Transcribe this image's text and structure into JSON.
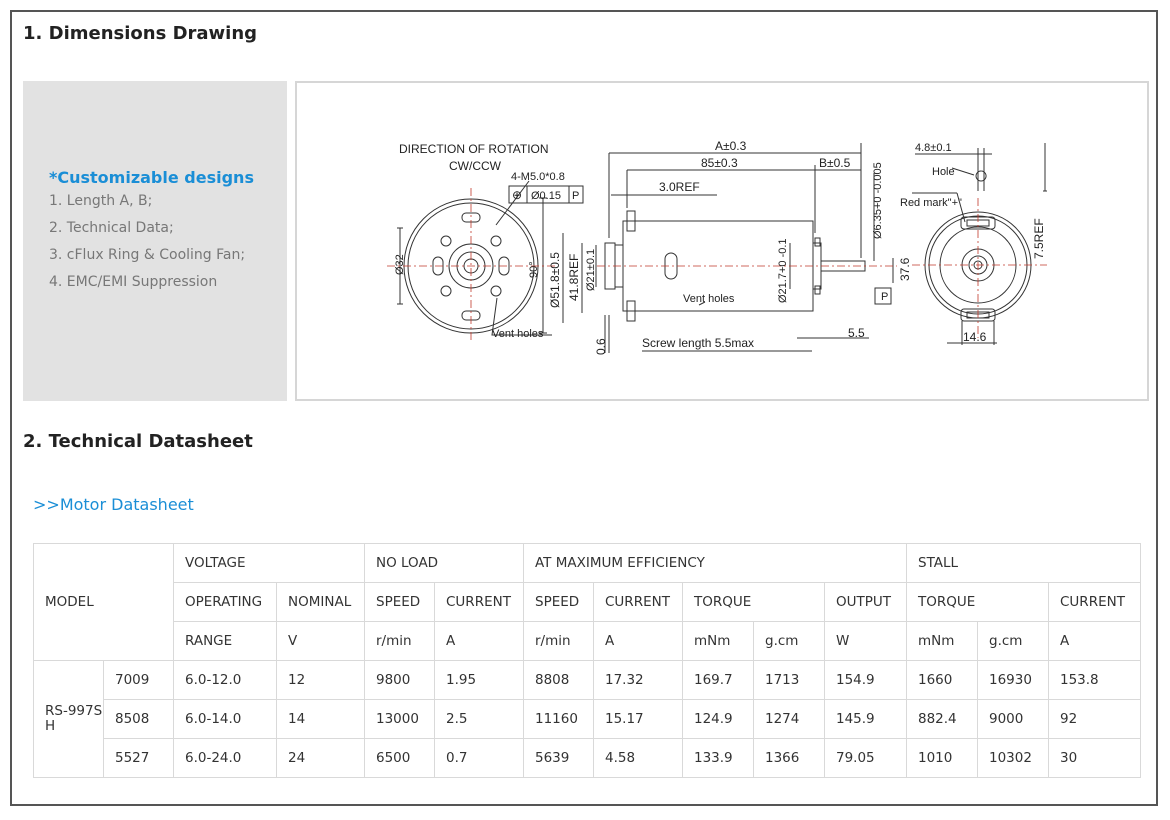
{
  "sections": {
    "dimensions_title": "1. Dimensions Drawing",
    "datasheet_title": "2. Technical Datasheet"
  },
  "custom": {
    "heading": "*Customizable designs",
    "items": [
      "1. Length A, B;",
      "2. Technical Data;",
      "3. cFlux Ring & Cooling Fan;",
      "4. EMC/EMI Suppression"
    ]
  },
  "drawing": {
    "rotation_title": "DIRECTION OF ROTATION",
    "rotation_value": "CW/CCW",
    "thread": "4-M5.0*0.8",
    "tolerance_symbol": "⊕",
    "tolerance": "Ø0.15",
    "datum": "P",
    "dim_a": "A±0.3",
    "dim_85": "85±0.3",
    "dim_b": "B±0.5",
    "dim_3ref": "3.0REF",
    "dim_shaft": "Ø6.35+0 -0.005",
    "dim_48": "4.8±0.1",
    "hole": "Hole",
    "red_mark": "Red mark\"+\"",
    "dim_75ref": "7.5REF",
    "dim_32": "Ø32",
    "dim_90": "90°",
    "dim_518": "Ø51.8±0.5",
    "dim_418": "41.8REF",
    "dim_21": "Ø21±0.1",
    "dim_217": "Ø21.7+0 -0.1",
    "dim_376": "37.6",
    "dim_06": "0.6",
    "dim_55": "5.5",
    "dim_146": "14.6",
    "vent_holes": "Vent holes",
    "screw": "Screw length 5.5max"
  },
  "datasheet_link": ">>Motor Datasheet",
  "table": {
    "model": "MODEL",
    "groups": {
      "voltage": "VOLTAGE",
      "no_load": "NO LOAD",
      "max_eff": "AT MAXIMUM EFFICIENCY",
      "stall": "STALL"
    },
    "row2": {
      "operating": "OPERATING",
      "nominal": "NOMINAL",
      "speed1": "SPEED",
      "current1": "CURRENT",
      "speed2": "SPEED",
      "current2": "CURRENT",
      "torque": "TORQUE",
      "output": "OUTPUT",
      "torque2": "TORQUE",
      "current3": "CURRENT"
    },
    "units": {
      "range": "RANGE",
      "v": "V",
      "rmin1": "r/min",
      "a1": "A",
      "rmin2": "r/min",
      "a2": "A",
      "mnm1": "mNm",
      "gcm1": "g.cm",
      "w": "W",
      "mnm2": "mNm",
      "gcm2": "g.cm",
      "a3": "A"
    },
    "model_name": "RS-997SH",
    "rows": [
      [
        "7009",
        "6.0-12.0",
        "12",
        "9800",
        "1.95",
        "8808",
        "17.32",
        "169.7",
        "1713",
        "154.9",
        "1660",
        "16930",
        "153.8"
      ],
      [
        "8508",
        "6.0-14.0",
        "14",
        "13000",
        "2.5",
        "11160",
        "15.17",
        "124.9",
        "1274",
        "145.9",
        "882.4",
        "9000",
        "92"
      ],
      [
        "5527",
        "6.0-24.0",
        "24",
        "6500",
        "0.7",
        "5639",
        "4.58",
        "133.9",
        "1366",
        "79.05",
        "1010",
        "10302",
        "30"
      ]
    ]
  }
}
